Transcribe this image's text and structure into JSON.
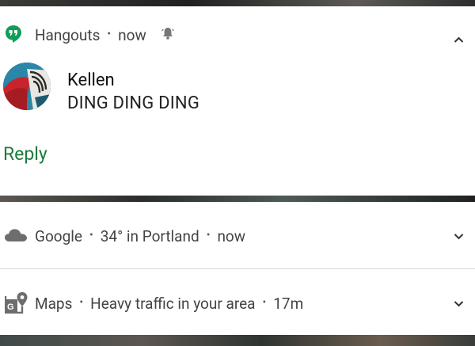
{
  "hangouts": {
    "app_name": "Hangouts",
    "separator": "•",
    "time": "now",
    "sender": "Kellen",
    "message": "DING DING DING",
    "reply_label": "Reply",
    "accent_color": "#0f9d58",
    "reply_color": "#1f7a3c"
  },
  "google": {
    "app_name": "Google",
    "separator": "•",
    "summary": "34° in Portland",
    "separator2": "•",
    "time": "now"
  },
  "maps": {
    "app_name": "Maps",
    "separator": "•",
    "summary": "Heavy traffic in your area",
    "separator2": "•",
    "time": "17m"
  }
}
